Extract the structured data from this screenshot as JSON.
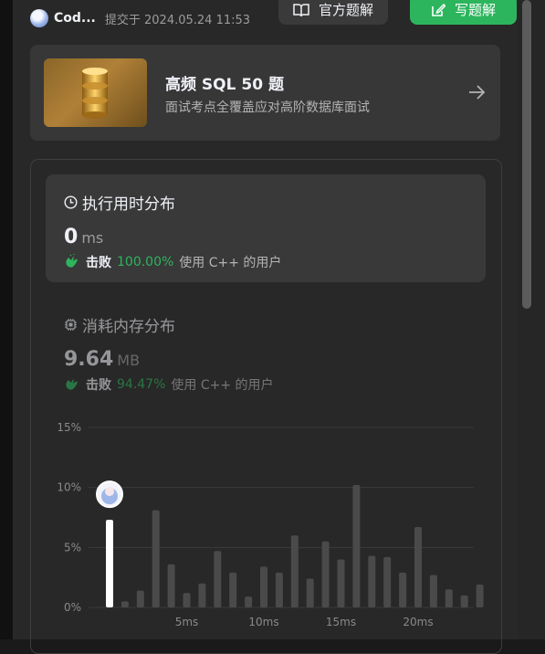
{
  "header": {
    "author": "Cod...",
    "submitted": "提交于 2024.05.24 11:53",
    "official_btn": "官方题解",
    "write_btn": "写题解"
  },
  "promo": {
    "title": "高频 SQL 50 题",
    "subtitle": "面试考点全覆盖应对高阶数据库面试"
  },
  "runtime": {
    "title": "执行用时分布",
    "value": "0",
    "unit": "ms",
    "beat_word": "击败",
    "beat_pct": "100.00%",
    "beat_tail": "使用 C++ 的用户"
  },
  "memory": {
    "title": "消耗内存分布",
    "value": "9.64",
    "unit": "MB",
    "beat_word": "击败",
    "beat_pct": "94.47%",
    "beat_tail": "使用 C++ 的用户"
  },
  "colors": {
    "green": "#2db55d",
    "bar": "#4a4a4a",
    "highlight_bar": "#ffffff",
    "grid": "#3a3a3a"
  },
  "icons": [
    "book-icon",
    "edit-icon",
    "database-icon",
    "arrow-right-icon",
    "clock-icon",
    "chip-icon",
    "clap-icon",
    "avatar-icon"
  ],
  "chart_data": {
    "type": "bar",
    "ylim": [
      0,
      15
    ],
    "yticks": [
      "15%",
      "10%",
      "5%",
      "0%"
    ],
    "ytick_values": [
      15,
      10,
      5,
      0
    ],
    "xticks": [
      "5ms",
      "10ms",
      "15ms",
      "20ms"
    ],
    "xtick_values": [
      5,
      10,
      15,
      20
    ],
    "x": [
      0,
      1,
      2,
      3,
      4,
      5,
      6,
      7,
      8,
      9,
      10,
      11,
      12,
      13,
      14,
      15,
      16,
      17,
      18,
      19,
      20,
      21,
      22,
      23,
      24
    ],
    "values": [
      7.3,
      0.5,
      1.4,
      8.1,
      3.6,
      1.2,
      2.0,
      4.7,
      2.9,
      0.9,
      3.4,
      2.9,
      6.0,
      2.4,
      5.5,
      4.0,
      10.2,
      4.3,
      4.2,
      2.9,
      6.7,
      2.7,
      1.5,
      1.0,
      1.9
    ],
    "highlight_index": 0,
    "grid": true
  }
}
